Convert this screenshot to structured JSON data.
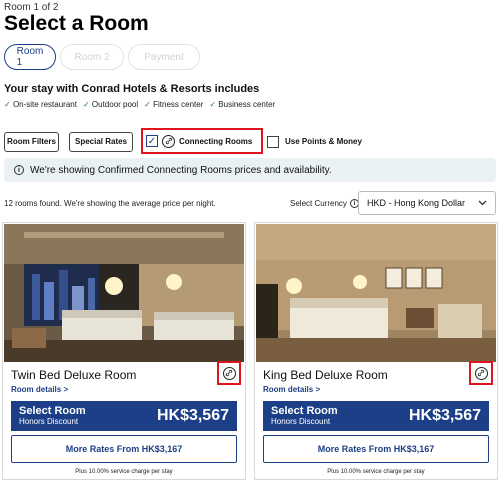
{
  "header": {
    "step": "Room 1 of 2",
    "title": "Select a Room"
  },
  "tabs": [
    {
      "label": "Room 1",
      "active": true
    },
    {
      "label": "Room 2",
      "active": false
    },
    {
      "label": "Payment",
      "active": false
    }
  ],
  "includes": {
    "title": "Your stay with Conrad Hotels & Resorts includes",
    "items": [
      "On-site restaurant",
      "Outdoor pool",
      "Fitness center",
      "Business center"
    ]
  },
  "filters": {
    "room_filters": "Room Filters",
    "special_rates": "Special Rates",
    "connecting_rooms": "Connecting Rooms",
    "connecting_checked": true,
    "use_points": "Use Points & Money"
  },
  "banner": {
    "text": "We're showing Confirmed Connecting Rooms prices and availability."
  },
  "results": {
    "summary": "12 rooms found. We're showing the average price per night.",
    "currency_label": "Select Currency",
    "currency_value": "HKD - Hong Kong Dollar"
  },
  "rooms": [
    {
      "name": "Twin Bed Deluxe Room",
      "details": "Room details >",
      "select_label": "Select Room",
      "discount": "Honors Discount",
      "price": "HK$3,567",
      "more_rates": "More Rates From HK$3,167",
      "service": "Plus 10.00% service charge per stay"
    },
    {
      "name": "King Bed Deluxe Room",
      "details": "Room details >",
      "select_label": "Select Room",
      "discount": "Honors Discount",
      "price": "HK$3,567",
      "more_rates": "More Rates From HK$3,167",
      "service": "Plus 10.00% service charge per stay"
    }
  ],
  "colors": {
    "brand": "#1d3f87",
    "highlight": "#e0141e",
    "banner_bg": "#eaf1f5"
  },
  "icons": [
    "checkmark-icon",
    "link-icon",
    "info-icon",
    "chevron-down-icon"
  ]
}
